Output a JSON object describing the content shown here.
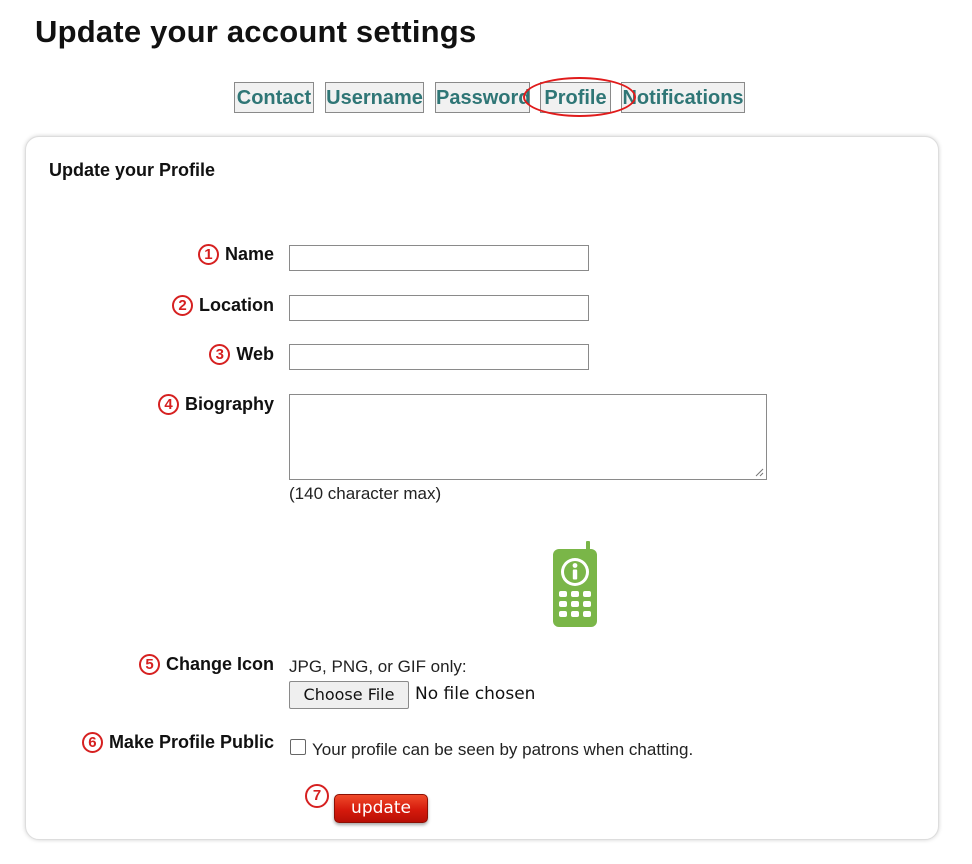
{
  "page_title": "Update your account settings",
  "tabs": [
    {
      "label": "Contact"
    },
    {
      "label": "Username"
    },
    {
      "label": "Password"
    },
    {
      "label": "Profile",
      "selected": true
    },
    {
      "label": "Notifications"
    }
  ],
  "panel": {
    "title": "Update your Profile",
    "fields": {
      "name": {
        "step": "1",
        "label": "Name",
        "value": ""
      },
      "location": {
        "step": "2",
        "label": "Location",
        "value": ""
      },
      "web": {
        "step": "3",
        "label": "Web",
        "value": ""
      },
      "biography": {
        "step": "4",
        "label": "Biography",
        "value": "",
        "hint": "(140 character max)"
      },
      "icon": {
        "step": "5",
        "label": "Change Icon",
        "hint": "JPG, PNG, or GIF only:",
        "button": "Choose File",
        "status": "No file chosen",
        "current_icon": "phone-info-icon"
      },
      "public": {
        "step": "6",
        "label": "Make Profile Public",
        "checked": false,
        "text": "Your profile can be seen by patrons when chatting."
      }
    },
    "submit": {
      "step": "7",
      "label": "update"
    }
  },
  "colors": {
    "tab_text": "#2f7676",
    "annotation_red": "#d62020",
    "icon_green": "#7ab648",
    "update_button": "#d51a0c"
  }
}
